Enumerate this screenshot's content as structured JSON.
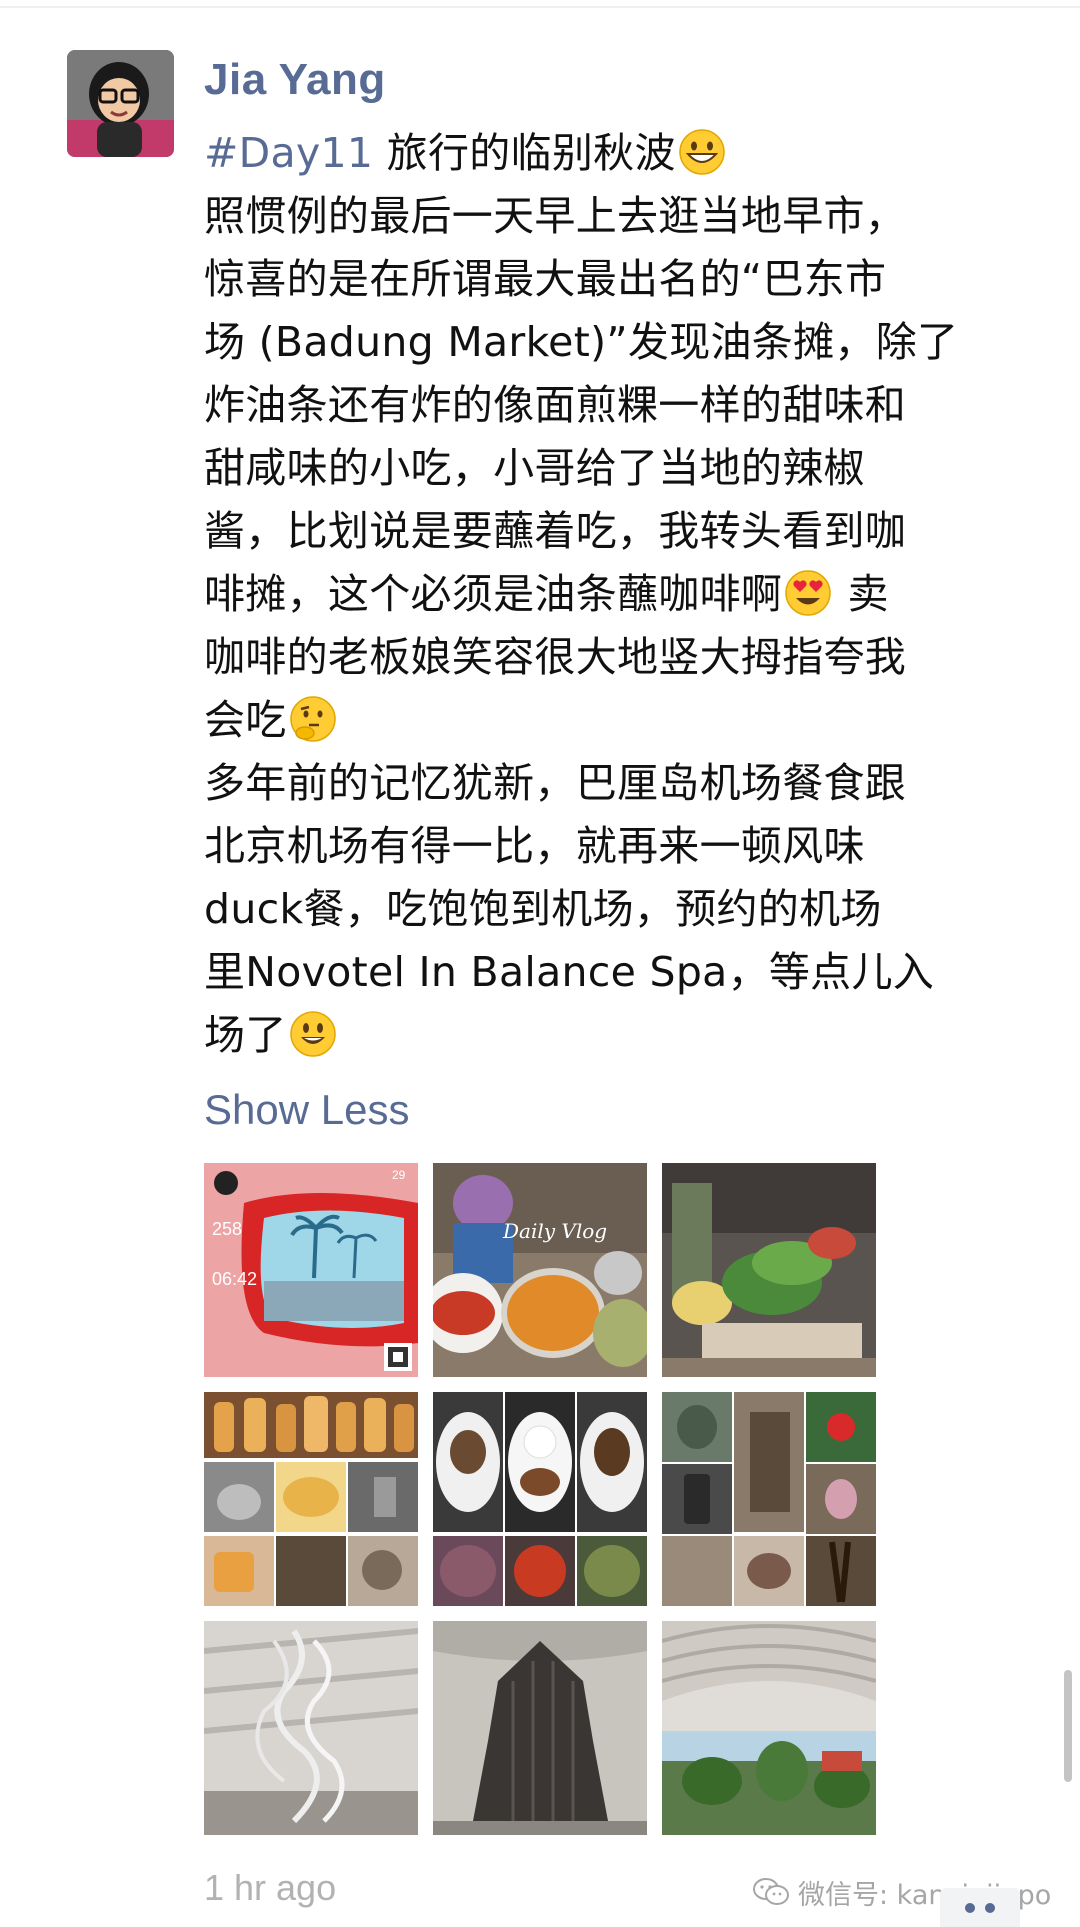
{
  "post": {
    "author": "Jia Yang",
    "hashtag": "#Day11",
    "lines": [
      "旅行的临别秋波",
      "照惯例的最后一天早上去逛当地早市，",
      "惊喜的是在所谓最大最出名的“巴东市",
      "场 (Badung Market)”发现油条摊，除了",
      "炸油条还有炸的像面煎粿一样的甜味和",
      "甜咸味的小吃，小哥给了当地的辣椒",
      "酱，比划说是要蘸着吃，我转头看到咖",
      "啡摊，这个必须是油条蘸咖啡啊",
      "卖",
      "咖啡的老板娘笑容很大地竖大拇指夸我",
      "会吃",
      "多年前的记忆犹新，巴厘岛机场餐食跟",
      "北京机场有得一比，就再来一顿风味",
      "duck餐，吃饱饱到机场，预约的机场",
      "里Novotel In Balance Spa，等点儿入",
      "场了"
    ],
    "emojis": [
      "grinning-face-emoji",
      "heart-eyes-emoji",
      "thinking-face-emoji",
      "smiley-face-emoji"
    ],
    "show_less_label": "Show Less",
    "timestamp": "1 hr ago"
  },
  "photos": {
    "items": [
      {
        "name": "photo-beach-sunglasses",
        "texts": [
          "258",
          "06:42",
          "29"
        ]
      },
      {
        "name": "photo-daily-vlog-market",
        "texts": [
          "Daily Vlog"
        ]
      },
      {
        "name": "photo-market-vegetables",
        "texts": []
      },
      {
        "name": "photo-fried-snacks-collage",
        "texts": []
      },
      {
        "name": "photo-duck-meal-collage",
        "texts": []
      },
      {
        "name": "photo-spa-collage",
        "texts": []
      },
      {
        "name": "photo-airport-sculpture",
        "texts": []
      },
      {
        "name": "photo-airport-tower-decor",
        "texts": []
      },
      {
        "name": "photo-airport-terminal",
        "texts": []
      }
    ]
  },
  "watermark": {
    "icon": "wechat-icon",
    "text": "微信号: kanxinjiapo"
  },
  "colors": {
    "link": "#576b95",
    "body_text": "#111111",
    "meta_text": "#b2b2b2"
  }
}
